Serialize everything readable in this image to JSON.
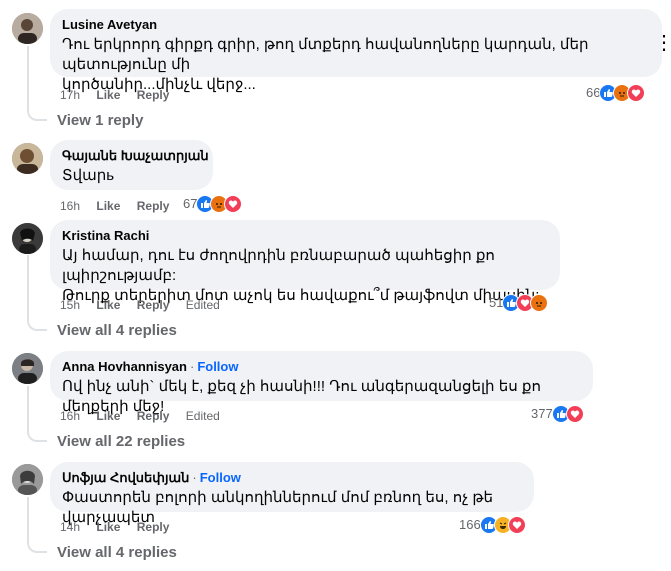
{
  "comments": [
    {
      "author": "Lusine Avetyan",
      "follow": "",
      "text_lines": [
        "Դու երկրորդ գիրքդ գրիր, թող մտքերդ հավանողները կարդան, մեր պետությունը մի",
        "կործանիր...մինչև վերջ..."
      ],
      "time": "17h",
      "like_label": "Like",
      "reply_label": "Reply",
      "edited_label": "",
      "reaction_count": "66",
      "reactions": [
        "like-icon",
        "angry-icon",
        "love-icon"
      ],
      "view_replies": "View 1 reply"
    },
    {
      "author": "Գայանե Խաչատրյան",
      "follow": "",
      "text_lines": [
        "Տվարь"
      ],
      "time": "16h",
      "like_label": "Like",
      "reply_label": "Reply",
      "edited_label": "",
      "reaction_count": "67",
      "reactions": [
        "like-icon",
        "angry-icon",
        "love-icon"
      ],
      "view_replies": ""
    },
    {
      "author": "Kristina Rachi",
      "follow": "",
      "text_lines": [
        "Այ համար, դու էս ժողովրդին բռնաբարած պահեցիր քո լպիրշությամբ:",
        "Թուրք տերերիտ մոտ աչոկ ես հավաքու՞մ թայֆովտ միասին:"
      ],
      "time": "15h",
      "like_label": "Like",
      "reply_label": "Reply",
      "edited_label": "Edited",
      "reaction_count": "51",
      "reactions": [
        "like-icon",
        "love-icon",
        "angry-icon"
      ],
      "view_replies": "View all 4 replies"
    },
    {
      "author": "Anna Hovhannisyan",
      "follow": "Follow",
      "text_lines": [
        "Ով ինչ անի` մեկ է, քեզ չի հասնի!!! Դու անգերազանցելի ես քո մեղքերի մեջ!"
      ],
      "time": "16h",
      "like_label": "Like",
      "reply_label": "Reply",
      "edited_label": "Edited",
      "reaction_count": "377",
      "reactions": [
        "like-icon",
        "love-icon"
      ],
      "view_replies": "View all 22 replies"
    },
    {
      "author": "Սոֆյա Հովսեփյան",
      "follow": "Follow",
      "text_lines": [
        "Փաստորեն բոլորի անկողիններում մոմ բռնող ես, ոչ թե վարչապետ"
      ],
      "time": "14h",
      "like_label": "Like",
      "reply_label": "Reply",
      "edited_label": "",
      "reaction_count": "166",
      "reactions": [
        "like-icon",
        "haha-icon",
        "love-icon"
      ],
      "view_replies": "View all 4 replies"
    }
  ],
  "colors": {
    "like": "#1877f2",
    "love": "#f33e58",
    "angry": "#e9710f",
    "haha": "#f7b125"
  }
}
